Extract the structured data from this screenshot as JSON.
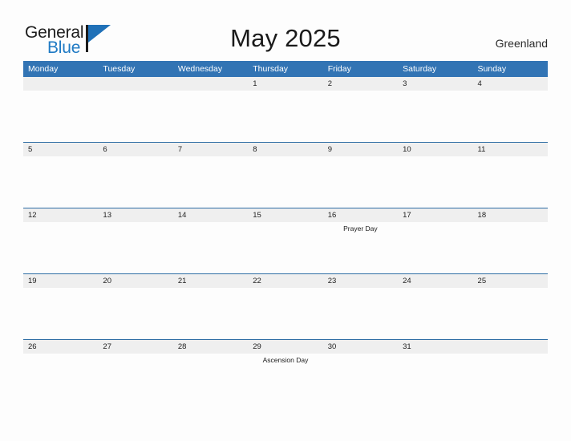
{
  "brand": {
    "word_one": "General",
    "word_two": "Blue",
    "flag_color": "#2071b8",
    "text_color": "#1c1c1c"
  },
  "header": {
    "title": "May 2025",
    "location": "Greenland",
    "accent_color": "#3274b4"
  },
  "calendar": {
    "weekday_headers": [
      "Monday",
      "Tuesday",
      "Wednesday",
      "Thursday",
      "Friday",
      "Saturday",
      "Sunday"
    ],
    "band_color": "#efefef",
    "rule_color": "#2e6da4",
    "weeks": [
      {
        "days": [
          {
            "date": "",
            "event": ""
          },
          {
            "date": "",
            "event": ""
          },
          {
            "date": "",
            "event": ""
          },
          {
            "date": "1",
            "event": ""
          },
          {
            "date": "2",
            "event": ""
          },
          {
            "date": "3",
            "event": ""
          },
          {
            "date": "4",
            "event": ""
          }
        ]
      },
      {
        "days": [
          {
            "date": "5",
            "event": ""
          },
          {
            "date": "6",
            "event": ""
          },
          {
            "date": "7",
            "event": ""
          },
          {
            "date": "8",
            "event": ""
          },
          {
            "date": "9",
            "event": ""
          },
          {
            "date": "10",
            "event": ""
          },
          {
            "date": "11",
            "event": ""
          }
        ]
      },
      {
        "days": [
          {
            "date": "12",
            "event": ""
          },
          {
            "date": "13",
            "event": ""
          },
          {
            "date": "14",
            "event": ""
          },
          {
            "date": "15",
            "event": ""
          },
          {
            "date": "16",
            "event": "Prayer Day"
          },
          {
            "date": "17",
            "event": ""
          },
          {
            "date": "18",
            "event": ""
          }
        ]
      },
      {
        "days": [
          {
            "date": "19",
            "event": ""
          },
          {
            "date": "20",
            "event": ""
          },
          {
            "date": "21",
            "event": ""
          },
          {
            "date": "22",
            "event": ""
          },
          {
            "date": "23",
            "event": ""
          },
          {
            "date": "24",
            "event": ""
          },
          {
            "date": "25",
            "event": ""
          }
        ]
      },
      {
        "days": [
          {
            "date": "26",
            "event": ""
          },
          {
            "date": "27",
            "event": ""
          },
          {
            "date": "28",
            "event": ""
          },
          {
            "date": "29",
            "event": "Ascension Day"
          },
          {
            "date": "30",
            "event": ""
          },
          {
            "date": "31",
            "event": ""
          },
          {
            "date": "",
            "event": ""
          }
        ]
      }
    ]
  }
}
